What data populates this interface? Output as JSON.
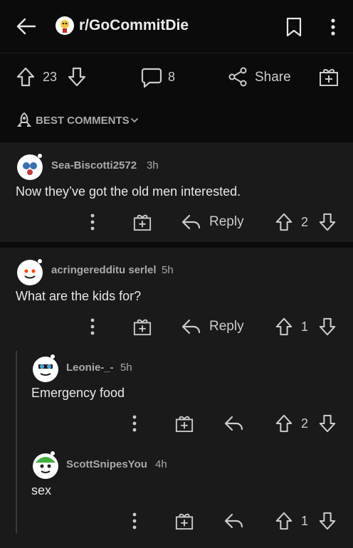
{
  "header": {
    "subreddit": "r/GoCommitDie"
  },
  "post_actions": {
    "upvotes": "23",
    "comments": "8",
    "share_label": "Share"
  },
  "sort": {
    "label": "BEST COMMENTS"
  },
  "comments": [
    {
      "user": "Sea-Biscotti2572",
      "age": "3h",
      "text": "Now they’ve got the old men interested.",
      "votes": "2",
      "reply_label": "Reply"
    },
    {
      "user": "acringeredditu serlel",
      "age": "5h",
      "text": "What are the kids for?",
      "votes": "1",
      "reply_label": "Reply"
    },
    {
      "user": "Leonie-_-",
      "age": "5h",
      "text": "Emergency food",
      "votes": "2"
    },
    {
      "user": "ScottSnipesYou",
      "age": "4h",
      "text": "sex",
      "votes": "1"
    }
  ],
  "colors": {
    "background": "#0b0b0b",
    "card": "#1a1a1b",
    "text": "#d7dadc",
    "accent_avatar": "#ff4500"
  }
}
